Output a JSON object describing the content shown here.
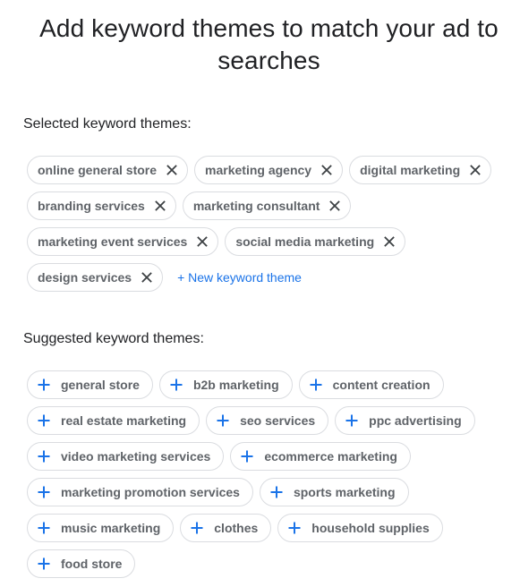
{
  "header": {
    "title": "Add keyword themes to match your ad to searches"
  },
  "selected": {
    "label": "Selected keyword themes:",
    "remove_icon": "close-icon",
    "items": [
      {
        "label": "online general store"
      },
      {
        "label": "marketing agency"
      },
      {
        "label": "digital marketing"
      },
      {
        "label": "branding services"
      },
      {
        "label": "marketing consultant"
      },
      {
        "label": "marketing event services"
      },
      {
        "label": "social media marketing"
      },
      {
        "label": "design services"
      }
    ],
    "new_theme_label": "+ New keyword theme"
  },
  "suggested": {
    "label": "Suggested keyword themes:",
    "add_icon": "plus-icon",
    "items": [
      {
        "label": "general store"
      },
      {
        "label": "b2b marketing"
      },
      {
        "label": "content creation"
      },
      {
        "label": "real estate marketing"
      },
      {
        "label": "seo services"
      },
      {
        "label": "ppc advertising"
      },
      {
        "label": "video marketing services"
      },
      {
        "label": "ecommerce marketing"
      },
      {
        "label": "marketing promotion services"
      },
      {
        "label": "sports marketing"
      },
      {
        "label": "music marketing"
      },
      {
        "label": "clothes"
      },
      {
        "label": "household supplies"
      },
      {
        "label": "food store"
      }
    ]
  },
  "colors": {
    "accent": "#1a73e8",
    "chip_text": "#5f6368",
    "chip_border": "#dadce0",
    "heading_text": "#202124"
  }
}
